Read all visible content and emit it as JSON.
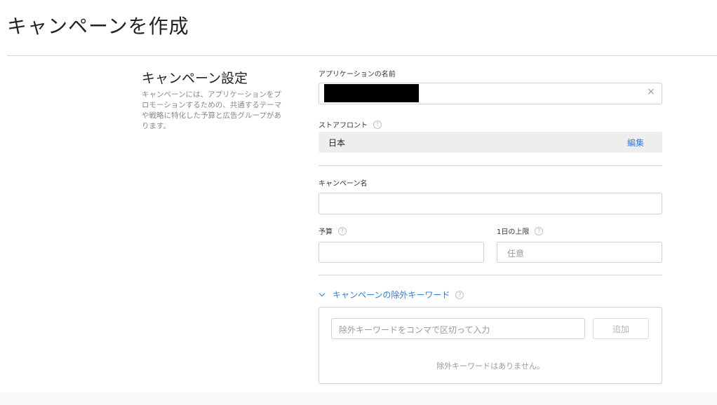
{
  "header": {
    "title": "キャンペーンを作成"
  },
  "sidebar": {
    "title": "キャンペーン設定",
    "description": "キャンペーンには、アプリケーションをプロモーションするための、共通するテーマや戦略に特化した予算と広告グループがあります。"
  },
  "form": {
    "app_name_label": "アプリケーションの名前",
    "app_name_clear": "×",
    "storefront_label": "ストアフロント",
    "storefront_value": "日本",
    "storefront_edit": "編集",
    "campaign_name_label": "キャンペーン名",
    "campaign_name_value": "",
    "budget_label": "予算",
    "budget_value": "",
    "daily_cap_label": "1日の上限",
    "daily_cap_placeholder": "任意",
    "help_glyph": "?"
  },
  "negative_keywords": {
    "toggle_label": "キャンペーンの除外キーワード",
    "input_placeholder": "除外キーワードをコンマで区切って入力",
    "add_button": "追加",
    "empty_message": "除外キーワードはありません。"
  }
}
